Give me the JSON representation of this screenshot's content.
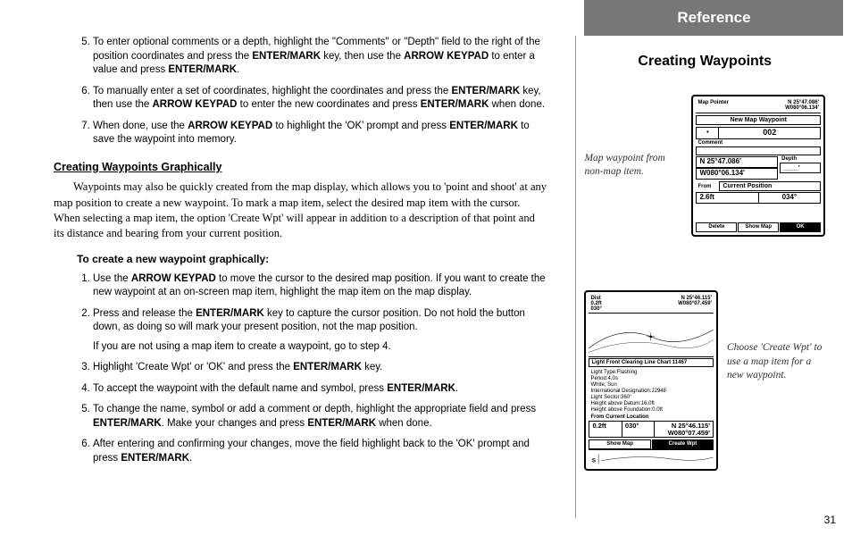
{
  "list1": {
    "start": 5,
    "items": [
      {
        "pre": "To enter optional comments or a depth, highlight the \"Comments\" or \"Depth\" field to the right of the position coordinates and press the ",
        "b1": "ENTER/MARK",
        "mid1": " key, then use the ",
        "b2": "ARROW KEYPAD",
        "mid2": " to enter a value and press ",
        "b3": "ENTER/MARK",
        "post": "."
      },
      {
        "pre": "To manually enter a set of coordinates, highlight the coordinates and press the ",
        "b1": "ENTER/MARK",
        "mid1": " key, then use the ",
        "b2": "ARROW KEYPAD",
        "mid2": " to enter the new coordinates and press ",
        "b3": "ENTER/MARK",
        "post": " when done."
      },
      {
        "pre": "When done, use the ",
        "b1": "ARROW KEYPAD",
        "mid1": " to highlight the 'OK' prompt and press ",
        "b2": "ENTER/MARK",
        "mid2": " to save the waypoint into memory.",
        "b3": "",
        "post": ""
      }
    ]
  },
  "section_title": "Creating Waypoints Graphically",
  "body_para": "Waypoints may also be quickly created from the map display, which allows you to 'point and shoot' at any map position to create a new waypoint. To mark a map item, select the desired map item with the cursor. When selecting a map item, the option 'Create Wpt' will appear in addition to a description of that point and its distance and bearing from your current position.",
  "instr_title": "To create a new waypoint graphically:",
  "list2": {
    "items": [
      {
        "segs": [
          {
            "t": "Use the "
          },
          {
            "t": "ARROW KEYPAD",
            "b": true
          },
          {
            "t": " to move the cursor to the desired map position. If you want to create the new waypoint at an on-screen map item, highlight the map item on the map display."
          }
        ]
      },
      {
        "segs": [
          {
            "t": "Press and release the "
          },
          {
            "t": "ENTER/MARK",
            "b": true
          },
          {
            "t": " key to capture the cursor position. Do not hold the button down, as doing so will mark your present position, not the map position."
          }
        ],
        "extra": "If you are not using a map item to create a waypoint, go to step 4."
      },
      {
        "segs": [
          {
            "t": "Highlight 'Create Wpt' or 'OK' and press the "
          },
          {
            "t": "ENTER/MARK",
            "b": true
          },
          {
            "t": " key."
          }
        ]
      },
      {
        "segs": [
          {
            "t": "To accept the waypoint with the default name and symbol, press "
          },
          {
            "t": "ENTER/MARK",
            "b": true
          },
          {
            "t": "."
          }
        ]
      },
      {
        "segs": [
          {
            "t": "To change the name, symbol or add a comment or depth, highlight the appropriate field and press "
          },
          {
            "t": "ENTER/MARK",
            "b": true
          },
          {
            "t": ". Make your changes and press "
          },
          {
            "t": "ENTER/MARK",
            "b": true
          },
          {
            "t": " when done."
          }
        ]
      },
      {
        "segs": [
          {
            "t": "After entering and confirming your changes, move the field highlight back to the 'OK' prompt and press "
          },
          {
            "t": "ENTER/MARK",
            "b": true
          },
          {
            "t": "."
          }
        ]
      }
    ]
  },
  "right": {
    "band": "Reference",
    "sub": "Creating Waypoints",
    "fig1_caption": "Map waypoint from non-map item.",
    "fig2_caption": "Choose 'Create Wpt' to use a map item for a new waypoint."
  },
  "dev1": {
    "top_left": "Map Pointer",
    "top_right_a": "N 25°47.086'",
    "top_right_b": "W080°06.134'",
    "title": "New Map Waypoint",
    "symbol": "•",
    "id": "002",
    "comment_label": "Comment",
    "coord_a": "N 25°47.086'",
    "coord_b": "W080°06.134'",
    "depth_label": "Depth",
    "depth_val": "____'",
    "from_label": "From",
    "from_val": "Current Position",
    "dist": "2.6ft",
    "brg": "034°",
    "btn1": "Delete",
    "btn2": "Show Map",
    "btn3": "OK"
  },
  "dev2": {
    "top_left_a": "Dist",
    "top_left_b": "0.2ft",
    "top_left_c": "030°",
    "top_right_a": "N 25°46.115'",
    "top_right_b": "W080°07.459'",
    "chart_label": "Light Front Clearing Line  Chart 11467",
    "info_lines": [
      "Light Type:Flashing",
      "Period:4.0s",
      "White, Sun",
      "International Designation:J2948",
      "Light Sector:360°",
      "Height above Datum:16.0ft",
      "Height above Foundation:0.0ft"
    ],
    "from_label": "From Current Location",
    "from_dist": "0.2ft",
    "from_brg": "030°",
    "from_coord_a": "N 25°46.115'",
    "from_coord_b": "W080°07.459'",
    "btn1": "Show Map",
    "btn2": "Create Wpt"
  },
  "page_number": "31"
}
